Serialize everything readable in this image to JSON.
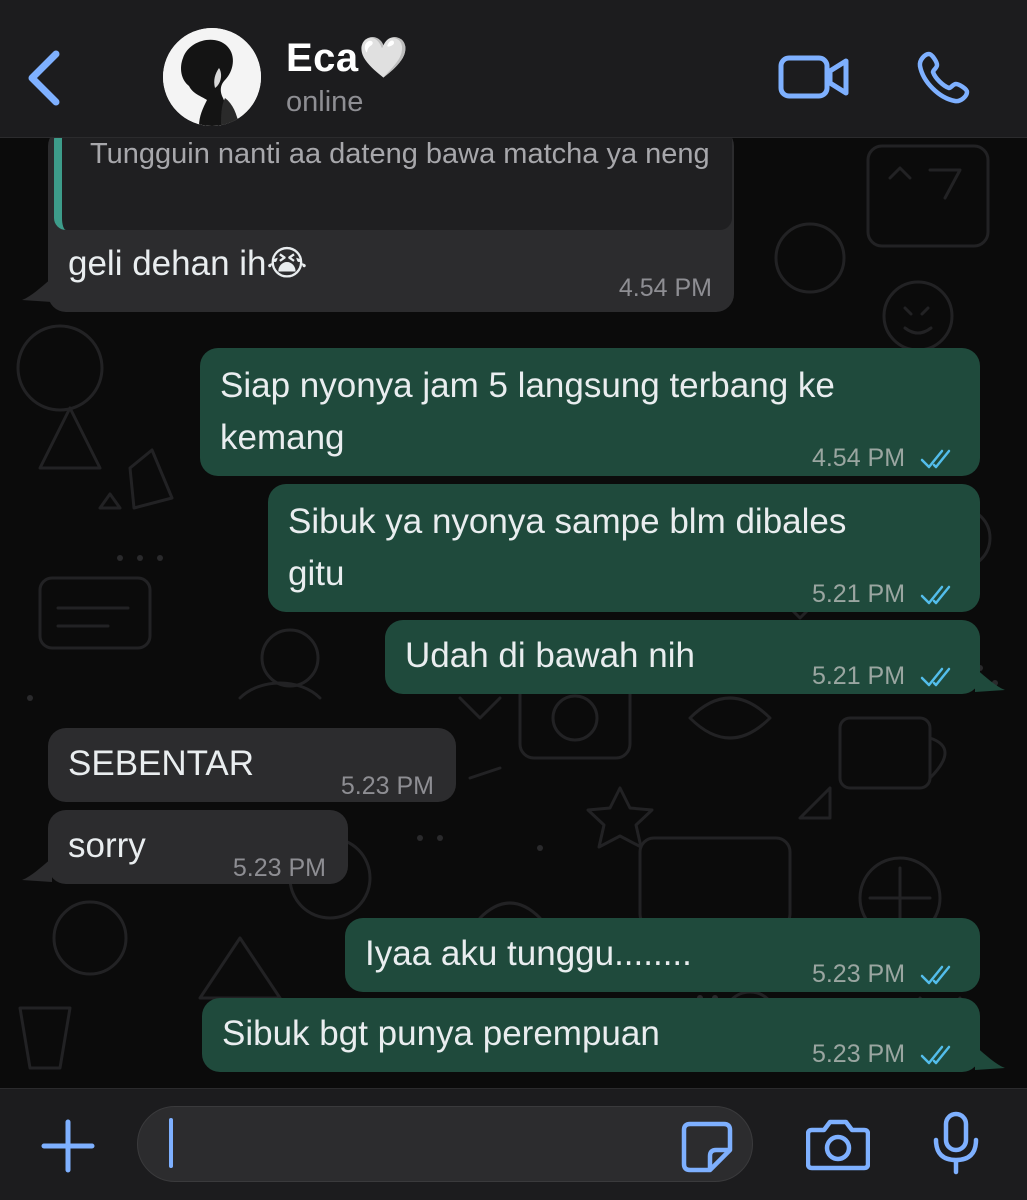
{
  "header": {
    "back_icon": "chevron-left-icon",
    "contact_name": "Eca",
    "name_emoji": "🤍",
    "status": "online",
    "video_icon": "video-camera-icon",
    "call_icon": "phone-icon"
  },
  "messages": [
    {
      "direction": "incoming",
      "quoted": "Tungguin nanti aa dateng bawa matcha ya neng",
      "text": "geli dehan ih😭",
      "time": "4.54 PM"
    },
    {
      "direction": "outgoing",
      "line1": "Siap nyonya jam 5 langsung terbang ke",
      "line2": "kemang",
      "time": "4.54 PM",
      "status": "read"
    },
    {
      "direction": "outgoing",
      "line1": "Sibuk ya nyonya sampe blm dibales",
      "line2": "gitu",
      "time": "5.21 PM",
      "status": "read"
    },
    {
      "direction": "outgoing",
      "text": "Udah di bawah nih",
      "time": "5.21 PM",
      "status": "read"
    },
    {
      "direction": "incoming",
      "text": "SEBENTAR",
      "time": "5.23 PM"
    },
    {
      "direction": "incoming",
      "text": "sorry",
      "time": "5.23 PM"
    },
    {
      "direction": "outgoing",
      "text": "Iyaa aku tunggu........",
      "time": "5.23 PM",
      "status": "read"
    },
    {
      "direction": "outgoing",
      "text": "Sibuk bgt punya perempuan",
      "time": "5.23 PM",
      "status": "read"
    }
  ],
  "input_bar": {
    "plus_icon": "plus-icon",
    "message_value": "",
    "sticker_icon": "sticker-icon",
    "camera_icon": "camera-icon",
    "mic_icon": "microphone-icon"
  },
  "colors": {
    "accent": "#7eb0ff",
    "outgoing_bubble": "#1f4a3c",
    "incoming_bubble": "#2c2c2e",
    "read_ticks": "#53bdeb"
  }
}
